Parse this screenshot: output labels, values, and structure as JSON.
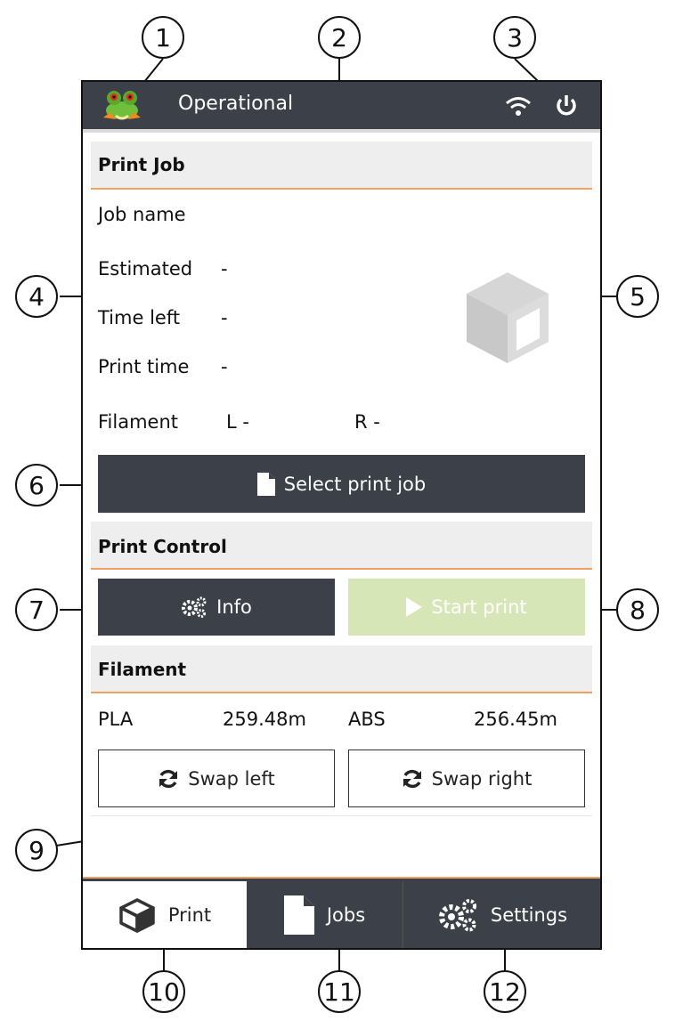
{
  "status": {
    "text": "Operational"
  },
  "print_job": {
    "title": "Print Job",
    "job_name_label": "Job name",
    "estimated_label": "Estimated",
    "estimated_value": "-",
    "time_left_label": "Time left",
    "time_left_value": "-",
    "print_time_label": "Print time",
    "print_time_value": "-",
    "filament_label": "Filament",
    "filament_left": "L -",
    "filament_right": "R -",
    "select_button": "Select print job"
  },
  "print_control": {
    "title": "Print Control",
    "info_button": "Info",
    "start_button": "Start print"
  },
  "filament": {
    "title": "Filament",
    "left_material": "PLA",
    "left_amount": "259.48m",
    "right_material": "ABS",
    "right_amount": "256.45m",
    "swap_left": "Swap left",
    "swap_right": "Swap right"
  },
  "nav": {
    "print": "Print",
    "jobs": "Jobs",
    "settings": "Settings"
  },
  "callouts": [
    "1",
    "2",
    "3",
    "4",
    "5",
    "6",
    "7",
    "8",
    "9",
    "10",
    "11",
    "12"
  ],
  "colors": {
    "dark": "#3c4049",
    "accent": "#f0a060",
    "start_disabled": "#d7e6b7"
  },
  "icons": [
    "frog-logo-icon",
    "wifi-icon",
    "power-icon",
    "cube-icon",
    "file-icon",
    "gears-icon",
    "play-icon",
    "refresh-icon"
  ]
}
